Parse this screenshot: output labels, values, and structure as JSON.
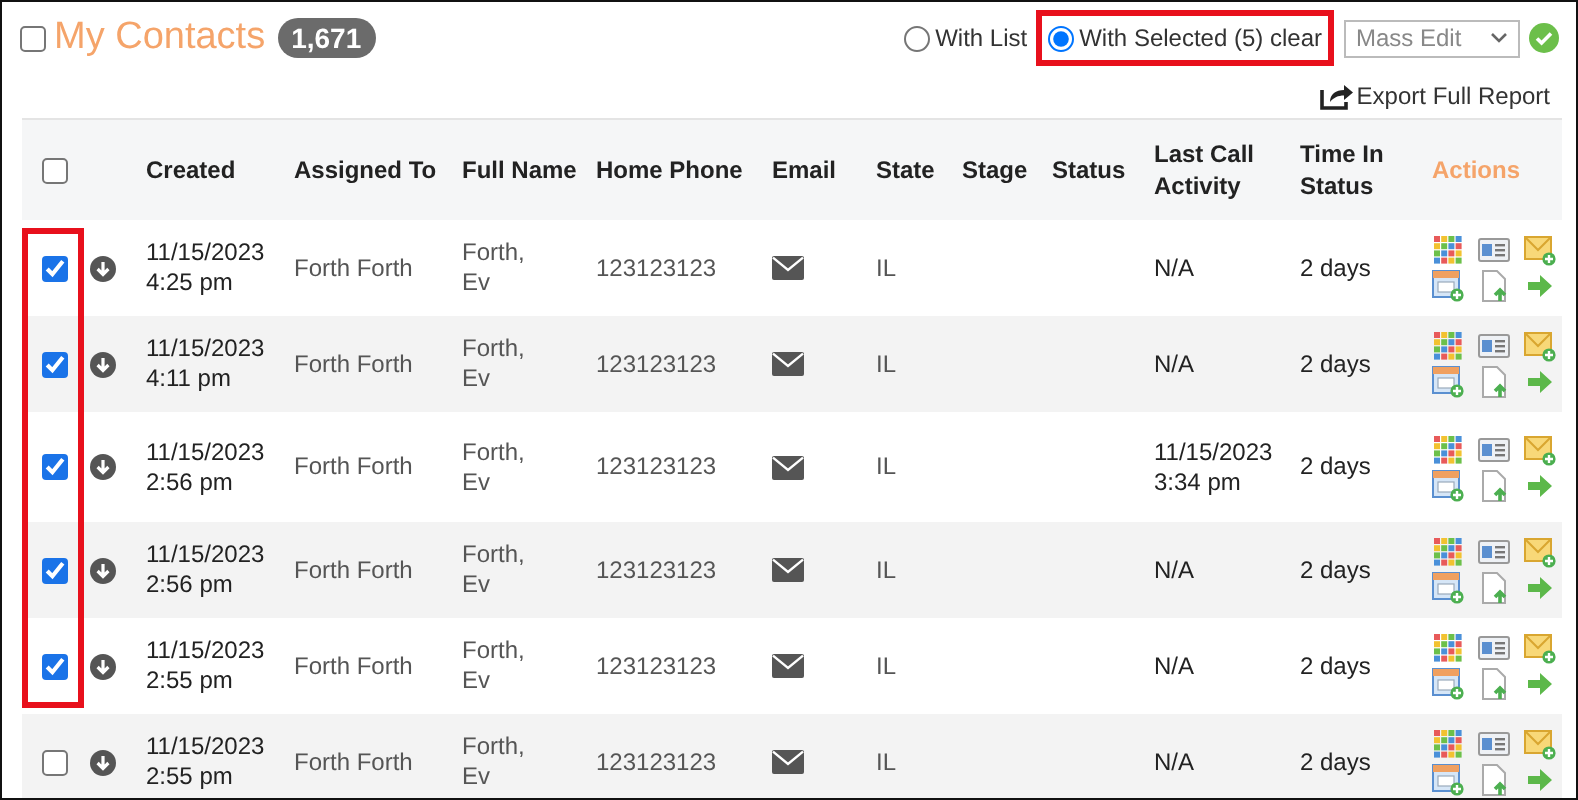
{
  "header": {
    "select_all_checked": false,
    "title": "My Contacts",
    "count": "1,671"
  },
  "scope_options": [
    {
      "label": "With List",
      "selected": false,
      "highlighted": false
    },
    {
      "label": "With Selected (5) clear",
      "selected": true,
      "highlighted": true
    }
  ],
  "bulk_action": {
    "value": "Mass Edit"
  },
  "export_link": "Export Full Report",
  "table": {
    "select_all_checked": false,
    "checkbox_column_highlighted": true,
    "columns": [
      "Created",
      "Assigned To",
      "Full Name",
      "Home Phone",
      "Email",
      "State",
      "Stage",
      "Status",
      "Last Call Activity",
      "Time In Status",
      "Actions"
    ],
    "rows": [
      {
        "checked": true,
        "created": "11/15/2023 4:25 pm",
        "assigned_to": "Forth Forth",
        "full_name": "Forth, Ev",
        "home_phone": "123123123",
        "state": "IL",
        "last_call": "N/A",
        "time_in_status": "2 days"
      },
      {
        "checked": true,
        "created": "11/15/2023 4:11 pm",
        "assigned_to": "Forth Forth",
        "full_name": "Forth, Ev",
        "home_phone": "123123123",
        "state": "IL",
        "last_call": "N/A",
        "time_in_status": "2 days"
      },
      {
        "checked": true,
        "created": "11/15/2023 2:56 pm",
        "assigned_to": "Forth Forth",
        "full_name": "Forth, Ev",
        "home_phone": "123123123",
        "state": "IL",
        "last_call": "11/15/2023 3:34 pm",
        "time_in_status": "2 days"
      },
      {
        "checked": true,
        "created": "11/15/2023 2:56 pm",
        "assigned_to": "Forth Forth",
        "full_name": "Forth, Ev",
        "home_phone": "123123123",
        "state": "IL",
        "last_call": "N/A",
        "time_in_status": "2 days"
      },
      {
        "checked": true,
        "created": "11/15/2023 2:55 pm",
        "assigned_to": "Forth Forth",
        "full_name": "Forth, Ev",
        "home_phone": "123123123",
        "state": "IL",
        "last_call": "N/A",
        "time_in_status": "2 days"
      },
      {
        "checked": false,
        "created": "11/15/2023 2:55 pm",
        "assigned_to": "Forth Forth",
        "full_name": "Forth, Ev",
        "home_phone": "123123123",
        "state": "IL",
        "last_call": "N/A",
        "time_in_status": "2 days"
      }
    ]
  }
}
